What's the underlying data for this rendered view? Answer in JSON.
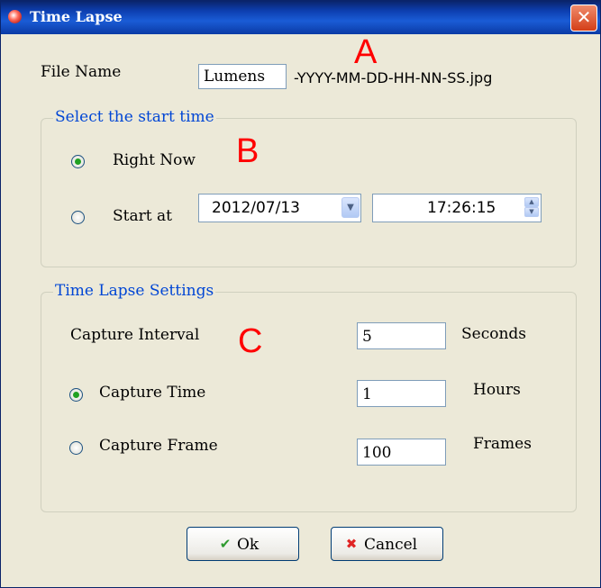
{
  "window": {
    "title": "Time Lapse",
    "close_glyph": "✕",
    "app_icon": "camera-icon"
  },
  "file_name": {
    "label": "File Name",
    "value": "Lumens",
    "suffix": "-YYYY-MM-DD-HH-NN-SS.jpg"
  },
  "start_time": {
    "group_title": "Select the start time",
    "right_now": {
      "label": "Right Now",
      "checked": true
    },
    "start_at": {
      "label": "Start at",
      "checked": false,
      "date": "2012/07/13",
      "time": "17:26:15"
    }
  },
  "settings": {
    "group_title": "Time Lapse Settings",
    "capture_interval": {
      "label": "Capture Interval",
      "value": "5",
      "unit": "Seconds"
    },
    "capture_time": {
      "label": "Capture Time",
      "value": "1",
      "unit": "Hours",
      "checked": true
    },
    "capture_frame": {
      "label": "Capture Frame",
      "value": "100",
      "unit": "Frames",
      "checked": false
    }
  },
  "buttons": {
    "ok": "Ok",
    "cancel": "Cancel"
  },
  "markers": {
    "a": "A",
    "b": "B",
    "c": "C"
  },
  "colors": {
    "group_title": "#0046d5",
    "radio_dot": "#21a121",
    "marker": "#ff0000"
  }
}
